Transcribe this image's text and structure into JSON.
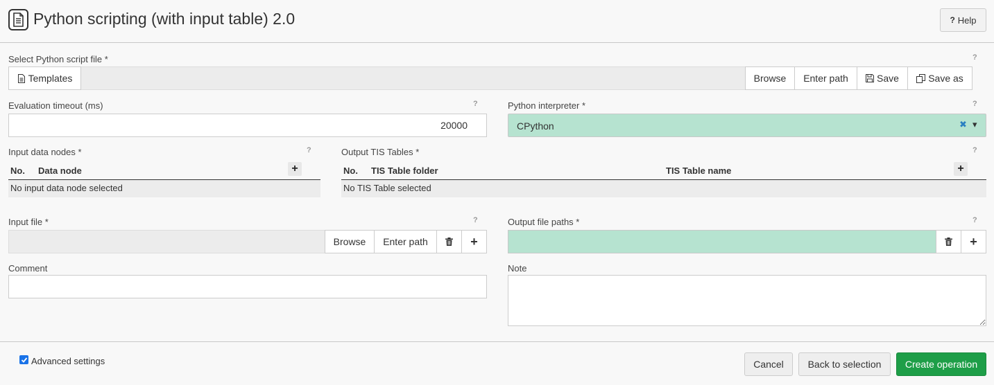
{
  "header": {
    "title": "Python scripting (with input table) 2.0",
    "help_label": "Help",
    "help_glyph": "?"
  },
  "script_file": {
    "label": "Select Python script file *",
    "help": "?",
    "templates_label": "Templates",
    "browse_label": "Browse",
    "enter_path_label": "Enter path",
    "save_label": "Save",
    "save_as_label": "Save as"
  },
  "timeout": {
    "label": "Evaluation timeout (ms)",
    "help": "?",
    "value": "20000"
  },
  "interpreter": {
    "label": "Python interpreter *",
    "help": "?",
    "value": "CPython",
    "clear_glyph": "✖",
    "caret_glyph": "▾"
  },
  "input_nodes": {
    "label": "Input data nodes *",
    "help": "?",
    "columns": [
      "No.",
      "Data node"
    ],
    "empty_text": "No input data node selected",
    "add_glyph": "+"
  },
  "output_tables": {
    "label": "Output TIS Tables *",
    "help": "?",
    "columns": [
      "No.",
      "TIS Table folder",
      "TIS Table name"
    ],
    "empty_text": "No TIS Table selected",
    "add_glyph": "+"
  },
  "input_file": {
    "label": "Input file *",
    "help": "?",
    "browse_label": "Browse",
    "enter_path_label": "Enter path",
    "add_glyph": "+"
  },
  "output_paths": {
    "label": "Output file paths *",
    "help": "?",
    "add_glyph": "+"
  },
  "comment": {
    "label": "Comment"
  },
  "note": {
    "label": "Note"
  },
  "footer": {
    "advanced_label": "Advanced settings",
    "advanced_checked": true,
    "cancel_label": "Cancel",
    "back_label": "Back to selection",
    "create_label": "Create operation"
  },
  "colors": {
    "selected_field": "#b6e3d0",
    "primary_button": "#1e9e48",
    "clear_icon": "#2a7fc1"
  }
}
